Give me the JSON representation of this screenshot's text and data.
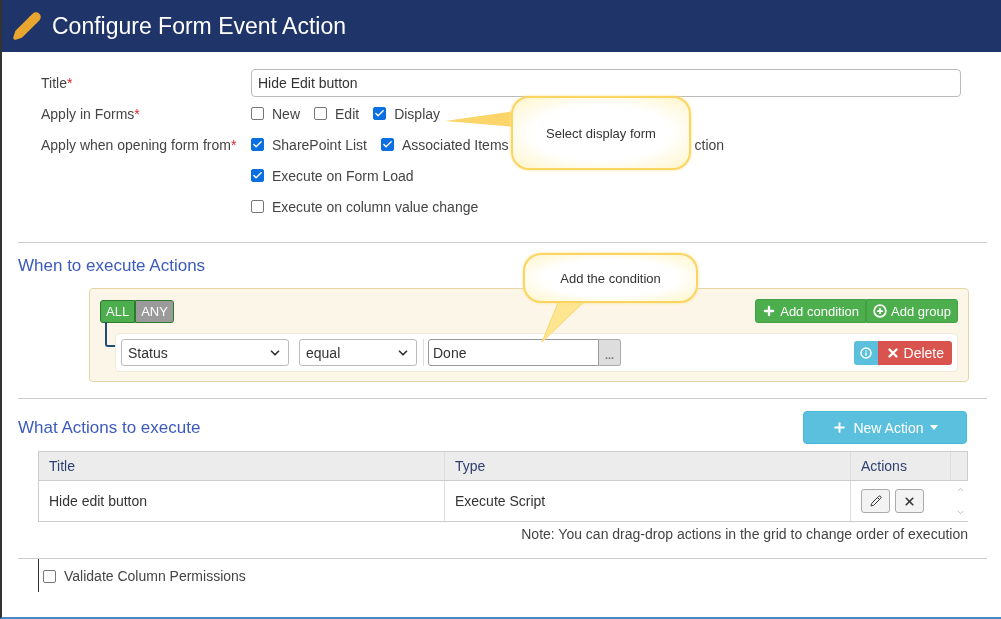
{
  "header": {
    "title": "Configure Form Event Action"
  },
  "form": {
    "title": {
      "label": "Title",
      "mark": "*",
      "value": "Hide Edit button"
    },
    "apply_in_forms": {
      "label": "Apply in Forms",
      "mark": "*",
      "options": [
        {
          "kind": "checkbox",
          "label": "New",
          "checked": false
        },
        {
          "kind": "checkbox",
          "label": "Edit",
          "checked": false
        },
        {
          "kind": "checkbox",
          "label": "Display",
          "checked": true
        }
      ]
    },
    "apply_when": {
      "label": "Apply when opening form from",
      "mark": "*",
      "options": [
        {
          "kind": "checkbox",
          "label": "SharePoint List",
          "checked": true
        },
        {
          "kind": "checkbox",
          "label": "Associated Items",
          "checked": true
        },
        {
          "kind": "fragment",
          "label": "ction"
        }
      ]
    },
    "execute_options": [
      {
        "label": "Execute on Form Load",
        "checked": true
      },
      {
        "label": "Execute on column value change",
        "checked": false
      }
    ]
  },
  "conditions": {
    "heading": "When to execute Actions",
    "toggle": [
      {
        "label": "ALL",
        "selected": true
      },
      {
        "label": "ANY",
        "selected": false
      }
    ],
    "buttons": [
      {
        "label": "Add condition",
        "kind": "plus"
      },
      {
        "label": "Add group",
        "kind": "circle-plus"
      }
    ],
    "rules": [
      {
        "field": "Status",
        "operator": "equal",
        "value": "Done",
        "more": "...",
        "delete": "Delete"
      }
    ]
  },
  "actions": {
    "heading": "What Actions to execute",
    "new_button": "New Action",
    "columns": [
      "Title",
      "Type",
      "Actions"
    ],
    "rows": [
      {
        "title": "Hide edit button",
        "type": "Execute Script"
      }
    ],
    "note": "Note: You can drag-drop actions in the grid to change order of execution"
  },
  "validate": {
    "label": "Validate Column Permissions",
    "checked": false
  },
  "callouts": [
    {
      "kind": "left",
      "text": "Select display form"
    },
    {
      "kind": "down",
      "text": "Add the condition"
    }
  ]
}
